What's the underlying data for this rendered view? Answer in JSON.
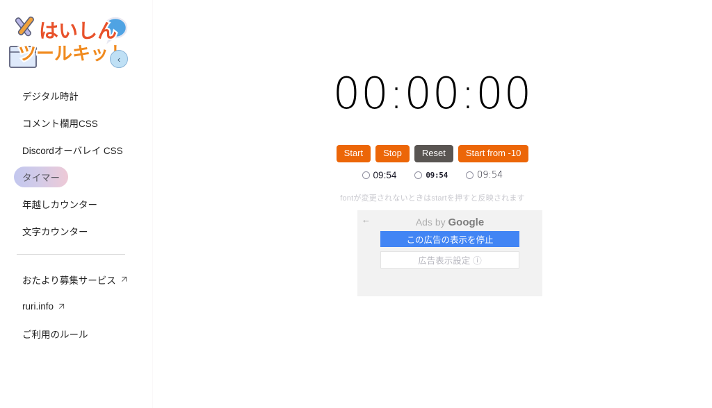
{
  "sidebar": {
    "logo_alt": "はいしんツールキット",
    "logo_line1": "はいしん",
    "logo_line2": "ツールキット",
    "collapse_label": "‹",
    "items": [
      {
        "label": "デジタル時計",
        "active": false,
        "external": false
      },
      {
        "label": "コメント欄用CSS",
        "active": false,
        "external": false
      },
      {
        "label": "Discordオーバレイ CSS",
        "active": false,
        "external": false
      },
      {
        "label": "タイマー",
        "active": true,
        "external": false
      },
      {
        "label": "年越しカウンター",
        "active": false,
        "external": false
      },
      {
        "label": "文字カウンター",
        "active": false,
        "external": false
      }
    ],
    "footer_items": [
      {
        "label": "おたより募集サービス",
        "external": true
      },
      {
        "label": "ruri.info",
        "external": true
      },
      {
        "label": "ご利用のルール",
        "external": false
      }
    ]
  },
  "timer": {
    "display": "00:00:00",
    "buttons": [
      {
        "label": "Start",
        "style": "orange"
      },
      {
        "label": "Stop",
        "style": "orange"
      },
      {
        "label": "Reset",
        "style": "gray"
      },
      {
        "label": "Start from -10",
        "style": "orange"
      }
    ],
    "font_options": [
      {
        "value": "09:54",
        "selected": false
      },
      {
        "value": "09:54",
        "selected": false
      },
      {
        "value": "09:54",
        "selected": false
      }
    ],
    "hint": "fontが変更されないときはstartを押すと反映されます"
  },
  "ad": {
    "back_label": "←",
    "title_prefix": "Ads by ",
    "title_brand": "Google",
    "stop_button": "この広告の表示を停止",
    "settings_button": "広告表示設定",
    "settings_icon": "ⓘ"
  },
  "colors": {
    "accent_orange": "#ec6608",
    "reset_gray": "#595552",
    "google_blue": "#4285f4",
    "active_gradient_start": "#c3c7ee",
    "active_gradient_end": "#eec9d6",
    "ad_panel_bg": "#f2f2f2"
  }
}
